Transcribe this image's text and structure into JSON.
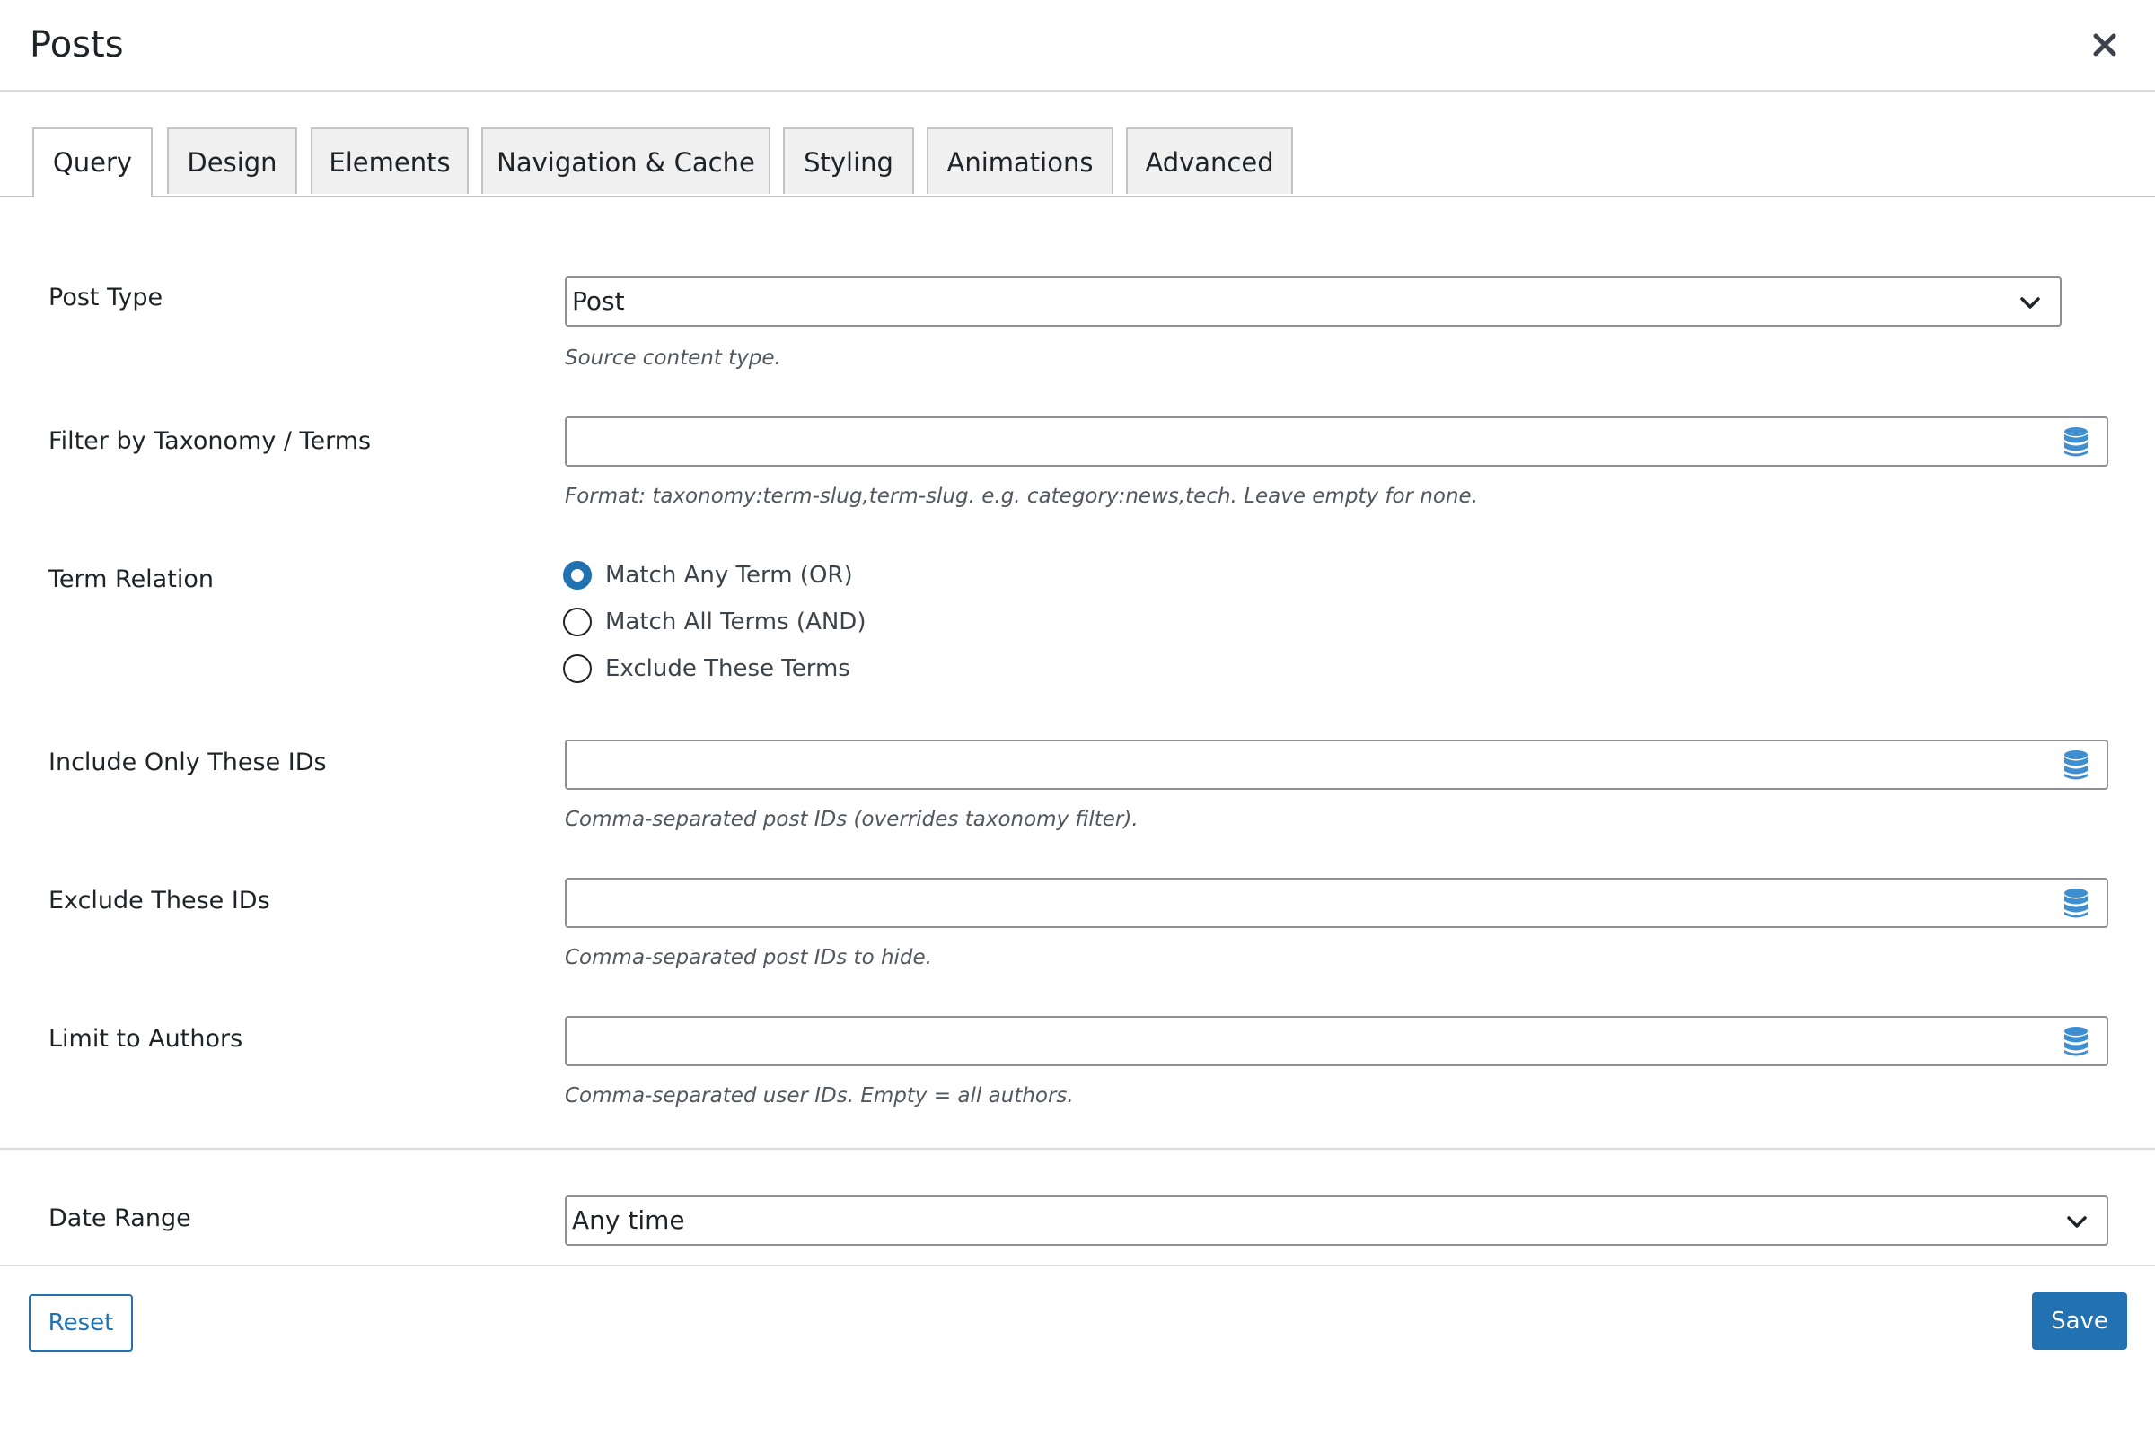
{
  "modal": {
    "title": "Posts"
  },
  "tabs": [
    {
      "label": "Query",
      "active": true
    },
    {
      "label": "Design",
      "active": false
    },
    {
      "label": "Elements",
      "active": false
    },
    {
      "label": "Navigation & Cache",
      "active": false
    },
    {
      "label": "Styling",
      "active": false
    },
    {
      "label": "Animations",
      "active": false
    },
    {
      "label": "Advanced",
      "active": false
    }
  ],
  "fields": {
    "post_type": {
      "label": "Post Type",
      "value": "Post",
      "help": "Source content type."
    },
    "taxonomy": {
      "label": "Filter by Taxonomy / Terms",
      "value": "",
      "help": "Format: taxonomy:term-slug,term-slug. e.g. category:news,tech. Leave empty for none."
    },
    "term_relation": {
      "label": "Term Relation",
      "options": [
        {
          "label": "Match Any Term (OR)",
          "checked": true
        },
        {
          "label": "Match All Terms (AND)",
          "checked": false
        },
        {
          "label": "Exclude These Terms",
          "checked": false
        }
      ]
    },
    "include_ids": {
      "label": "Include Only These IDs",
      "value": "",
      "help": "Comma-separated post IDs (overrides taxonomy filter)."
    },
    "exclude_ids": {
      "label": "Exclude These IDs",
      "value": "",
      "help": "Comma-separated post IDs to hide."
    },
    "authors": {
      "label": "Limit to Authors",
      "value": "",
      "help": "Comma-separated user IDs. Empty = all authors."
    },
    "date_range": {
      "label": "Date Range",
      "value": "Any time"
    }
  },
  "footer": {
    "reset_label": "Reset",
    "save_label": "Save"
  },
  "colors": {
    "accent": "#2271b1",
    "border": "#8c8f94",
    "tab_bg": "#f0f0f1",
    "db_icon": "#3e8ed0"
  },
  "icons": {
    "close": "close-icon",
    "select": "chevron-down-icon",
    "dynamic_data": "database-icon"
  }
}
